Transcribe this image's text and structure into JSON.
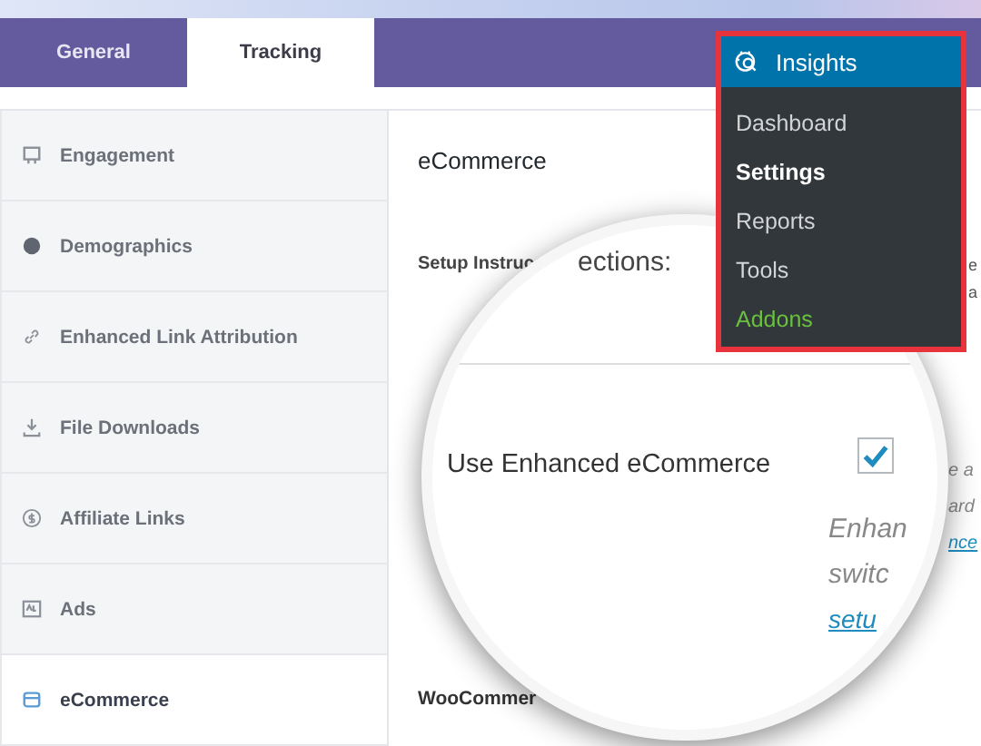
{
  "tabs": [
    {
      "label": "General",
      "selected": false
    },
    {
      "label": "Tracking",
      "selected": true
    }
  ],
  "sidebar": {
    "items": [
      {
        "label": "Engagement",
        "selected": false
      },
      {
        "label": "Demographics",
        "selected": false
      },
      {
        "label": "Enhanced Link Attribution",
        "selected": false
      },
      {
        "label": "File Downloads",
        "selected": false
      },
      {
        "label": "Affiliate Links",
        "selected": false
      },
      {
        "label": "Ads",
        "selected": false
      },
      {
        "label": "eCommerce",
        "selected": true
      }
    ]
  },
  "panel": {
    "heading": "eCommerce",
    "setup_label": "Setup Instruc",
    "right_fragments": [
      "e",
      "a"
    ],
    "lower_right_fragments": [
      "e a",
      "ard"
    ],
    "lower_right_link": "nce",
    "woocommerce_label": "WooCommer"
  },
  "magnifier": {
    "heading_fragment": "ections:",
    "option_label": "Use Enhanced eCommerce",
    "checked": true,
    "description_lines": [
      "Enhan",
      "switc"
    ],
    "link": "setu"
  },
  "menu": {
    "title": "Insights",
    "items": [
      {
        "label": "Dashboard",
        "selected": false,
        "kind": "page"
      },
      {
        "label": "Settings",
        "selected": true,
        "kind": "page"
      },
      {
        "label": "Reports",
        "selected": false,
        "kind": "page"
      },
      {
        "label": "Tools",
        "selected": false,
        "kind": "page"
      },
      {
        "label": "Addons",
        "selected": false,
        "kind": "addon"
      }
    ]
  }
}
